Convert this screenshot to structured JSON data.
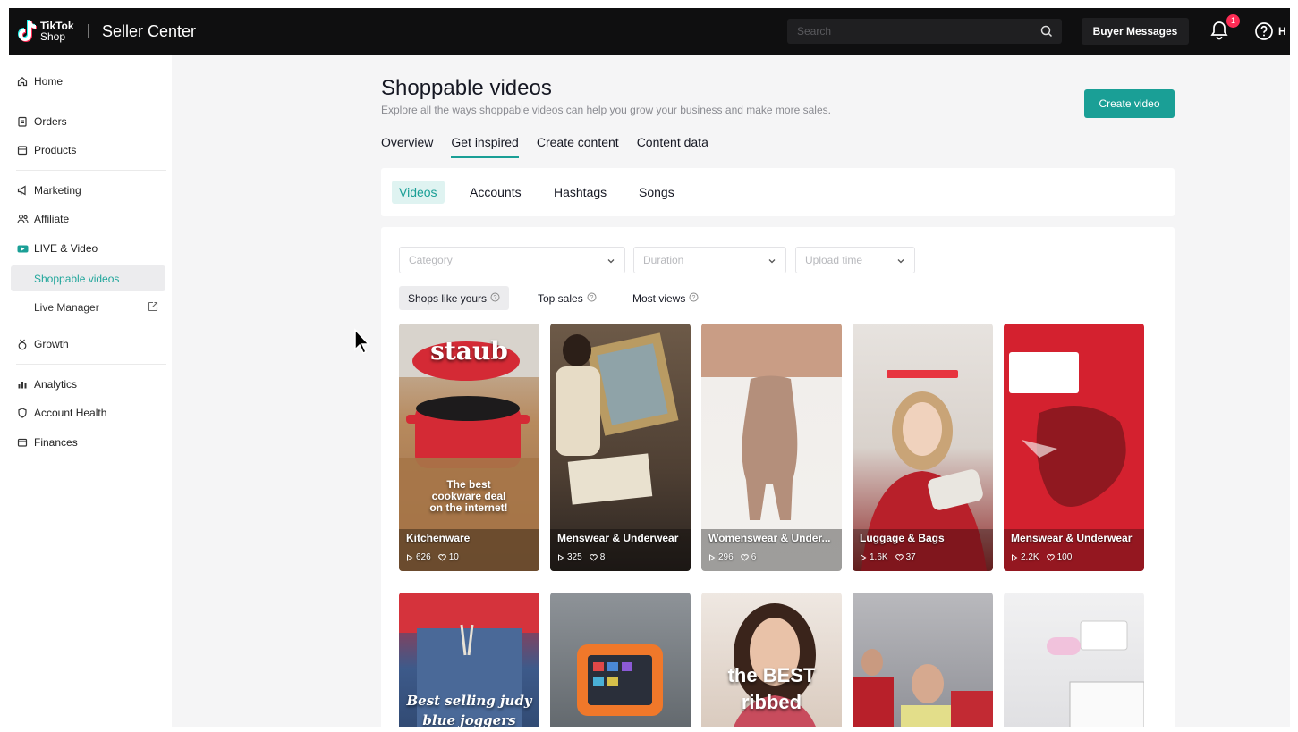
{
  "header": {
    "logo_line1": "TikTok",
    "logo_line2": "Shop",
    "app_title": "Seller Center",
    "search_placeholder": "Search",
    "buyer_messages": "Buyer Messages",
    "notification_count": "1",
    "help_label": "H"
  },
  "sidebar": {
    "items": [
      {
        "label": "Home",
        "icon": "home-icon"
      },
      {
        "label": "Orders",
        "icon": "clipboard-icon"
      },
      {
        "label": "Products",
        "icon": "box-icon"
      },
      {
        "label": "Marketing",
        "icon": "megaphone-icon"
      },
      {
        "label": "Affiliate",
        "icon": "people-icon"
      },
      {
        "label": "LIVE & Video",
        "icon": "video-icon"
      },
      {
        "label": "Shoppable videos",
        "icon": ""
      },
      {
        "label": "Live Manager",
        "icon": "external-link-icon"
      },
      {
        "label": "Growth",
        "icon": "medal-icon"
      },
      {
        "label": "Analytics",
        "icon": "bar-chart-icon"
      },
      {
        "label": "Account Health",
        "icon": "shield-icon"
      },
      {
        "label": "Finances",
        "icon": "wallet-icon"
      }
    ]
  },
  "page": {
    "title": "Shoppable videos",
    "subtitle": "Explore all the ways shoppable videos can help you grow your business and make more sales.",
    "create_button": "Create video",
    "tabs": [
      "Overview",
      "Get inspired",
      "Create content",
      "Content data"
    ],
    "active_tab": "Get inspired",
    "subtabs": [
      "Videos",
      "Accounts",
      "Hashtags",
      "Songs"
    ],
    "active_subtab": "Videos",
    "filters": {
      "category_placeholder": "Category",
      "duration_placeholder": "Duration",
      "upload_time_placeholder": "Upload time"
    },
    "sort_options": [
      "Shops like yours",
      "Top sales",
      "Most views"
    ],
    "active_sort": "Shops like yours"
  },
  "videos": [
    {
      "category": "Kitchenware",
      "views": "626",
      "likes": "10",
      "overlay": "staub",
      "caption": "The best cookware deal on the internet!"
    },
    {
      "category": "Menswear & Underwear",
      "views": "325",
      "likes": "8"
    },
    {
      "category": "Womenswear & Under...",
      "views": "296",
      "likes": "6"
    },
    {
      "category": "Luggage & Bags",
      "views": "1.6K",
      "likes": "37"
    },
    {
      "category": "Menswear & Underwear",
      "views": "2.2K",
      "likes": "100"
    },
    {
      "overlay": "Best selling judy blue joggers"
    },
    {},
    {
      "overlay": "the BEST ribbed"
    },
    {},
    {}
  ],
  "colors": {
    "accent": "#1a9f96",
    "topbar": "#0f0f10",
    "badge": "#fe2c55"
  }
}
